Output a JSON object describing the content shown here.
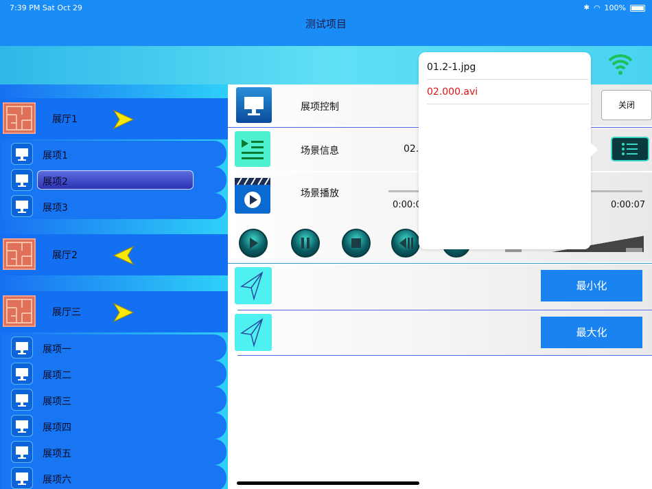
{
  "status_bar": {
    "time": "7:39 PM",
    "date": "Sat Oct 29",
    "battery": "100%"
  },
  "nav": {
    "title": "测试项目"
  },
  "sidebar": {
    "halls": [
      {
        "label": "展厅1",
        "arrow": "right"
      },
      {
        "label": "展厅2",
        "arrow": "left"
      },
      {
        "label": "展厅三",
        "arrow": "right"
      }
    ],
    "items_group1": [
      "展项1",
      "展项2",
      "展项3"
    ],
    "items_group3": [
      "展项一",
      "展项二",
      "展项三",
      "展项四",
      "展项五",
      "展项六"
    ],
    "selected": "展项2"
  },
  "main": {
    "row1_label": "展项控制",
    "row1_close": "关闭",
    "row2_label": "场景信息",
    "row2_value": "02.0",
    "row3_label": "场景播放",
    "time_start": "0:00:0",
    "time_end": "0:00:07",
    "minimize_label": "最小化",
    "maximize_label": "最大化"
  },
  "popover": {
    "items": [
      {
        "label": "01.2-1.jpg",
        "color": "#111111"
      },
      {
        "label": "02.000.avi",
        "color": "#e01010"
      }
    ]
  },
  "colors": {
    "nav_blue": "#1a8cf5",
    "sidebar_blue": "#1470f3",
    "button_blue": "#1a83f0",
    "selected_file": "#e01010"
  },
  "icons": {
    "monitor": "monitor-icon",
    "floorplan": "floorplan-icon",
    "play_arrow": "yellow-arrow-icon",
    "wifi": "wifi-icon",
    "send": "paper-plane-icon",
    "list": "list-icon",
    "video": "video-play-icon"
  }
}
